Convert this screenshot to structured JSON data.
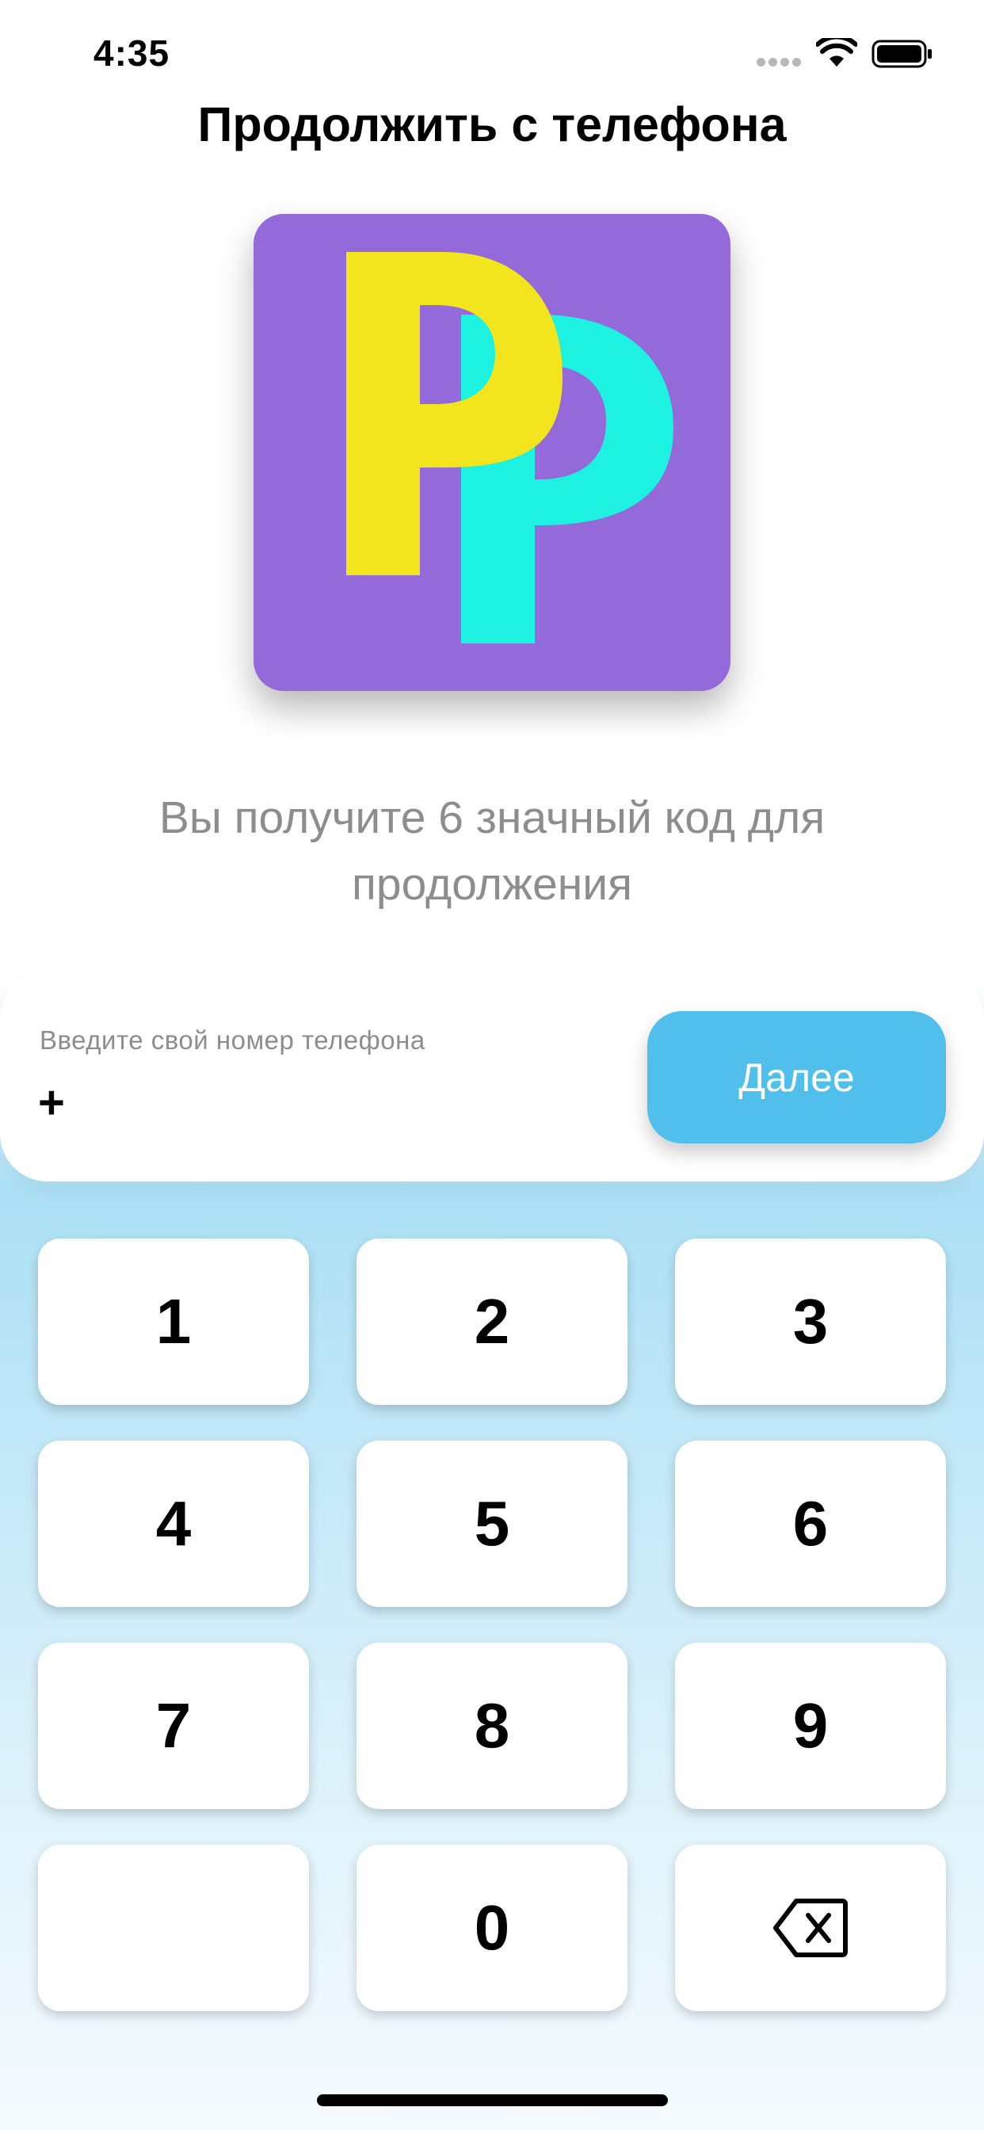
{
  "status_bar": {
    "time": "4:35",
    "icons": [
      "signal-dots-icon",
      "wifi-icon",
      "battery-icon"
    ]
  },
  "title": "Продолжить с телефона",
  "logo": {
    "icon": "app-logo-icon",
    "colors": {
      "background": "#9469d9",
      "letter_back": "#1df2e1",
      "letter_front": "#f2e41d"
    }
  },
  "subtitle": "Вы получите 6 значный код для продолжения",
  "phone_form": {
    "label": "Введите свой номер телефона",
    "value": "+",
    "next_button": "Далее",
    "accent": "#50bfeb"
  },
  "keypad": {
    "keys": [
      {
        "label": "1"
      },
      {
        "label": "2"
      },
      {
        "label": "3"
      },
      {
        "label": "4"
      },
      {
        "label": "5"
      },
      {
        "label": "6"
      },
      {
        "label": "7"
      },
      {
        "label": "8"
      },
      {
        "label": "9"
      },
      {
        "label": ""
      },
      {
        "label": "0"
      },
      {
        "label": "",
        "icon": "backspace-icon"
      }
    ]
  }
}
